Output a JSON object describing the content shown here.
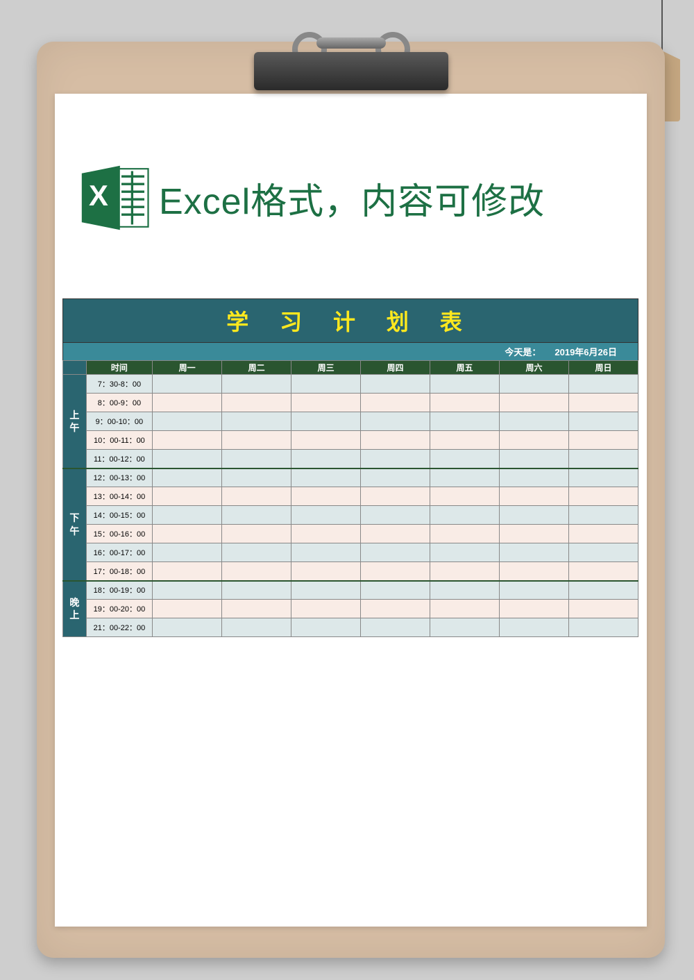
{
  "header": {
    "excel_label": "Excel格式，内容可修改"
  },
  "schedule": {
    "title": "学 习 计 划 表",
    "date_label": "今天是：",
    "date_value": "2019年6月26日",
    "headers": {
      "time": "时间",
      "days": [
        "周一",
        "周二",
        "周三",
        "周四",
        "周五",
        "周六",
        "周日"
      ]
    },
    "periods": [
      {
        "name": "上午",
        "slots": [
          "7：30-8：00",
          "8：00-9：00",
          "9：00-10：00",
          "10：00-11：00",
          "11：00-12：00"
        ]
      },
      {
        "name": "下午",
        "slots": [
          "12：00-13：00",
          "13：00-14：00",
          "14：00-15：00",
          "15：00-16：00",
          "16：00-17：00",
          "17：00-18：00"
        ]
      },
      {
        "name": "晚上",
        "slots": [
          "18：00-19：00",
          "19：00-20：00",
          "21：00-22：00"
        ]
      }
    ]
  }
}
